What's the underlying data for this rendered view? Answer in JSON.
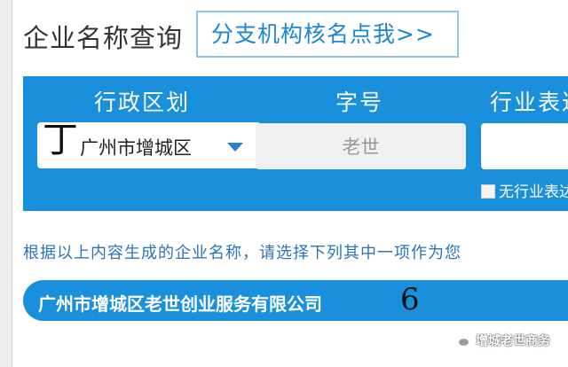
{
  "page": {
    "title": "企业名称查询",
    "branch_link": "分支机构核名点我>>"
  },
  "form": {
    "labels": {
      "region": "行政区划",
      "zihao": "字号",
      "industry": "行业表达"
    },
    "region": {
      "value": "广州市增城区"
    },
    "zihao": {
      "value": "老世"
    },
    "industry": {
      "value": ""
    },
    "no_industry_label": "无行业表达"
  },
  "cursor_mark": "丁",
  "instruction": "根据以上内容生成的企业名称，请选择下列其中一项作为您",
  "result": {
    "name": "广州市增城区老世创业服务有限公司"
  },
  "handwritten_mark": "6",
  "watermark": "增城老世商务",
  "colors": {
    "panel_blue": "#1a8fdb",
    "link_blue": "#1c86d6",
    "instruction_blue": "#2b74b9"
  }
}
